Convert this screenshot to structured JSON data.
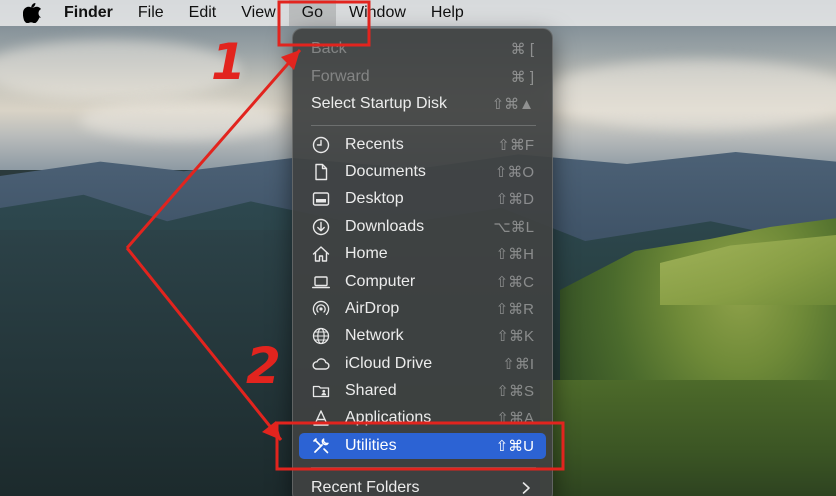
{
  "menubar": {
    "apple_icon": "apple-logo-icon",
    "app_name": "Finder",
    "items": [
      "File",
      "Edit",
      "View",
      "Go",
      "Window",
      "Help"
    ]
  },
  "go_menu": {
    "back": {
      "label": "Back",
      "shortcut": "⌘ ["
    },
    "forward": {
      "label": "Forward",
      "shortcut": "⌘ ]"
    },
    "startup": {
      "label": "Select Startup Disk",
      "shortcut": "⇧⌘▲"
    },
    "items": [
      {
        "label": "Recents",
        "shortcut": "⇧⌘F",
        "icon": "clock-icon"
      },
      {
        "label": "Documents",
        "shortcut": "⇧⌘O",
        "icon": "document-icon"
      },
      {
        "label": "Desktop",
        "shortcut": "⇧⌘D",
        "icon": "desktop-icon"
      },
      {
        "label": "Downloads",
        "shortcut": "⌥⌘L",
        "icon": "download-icon"
      },
      {
        "label": "Home",
        "shortcut": "⇧⌘H",
        "icon": "home-icon"
      },
      {
        "label": "Computer",
        "shortcut": "⇧⌘C",
        "icon": "laptop-icon"
      },
      {
        "label": "AirDrop",
        "shortcut": "⇧⌘R",
        "icon": "airdrop-icon"
      },
      {
        "label": "Network",
        "shortcut": "⇧⌘K",
        "icon": "globe-icon"
      },
      {
        "label": "iCloud Drive",
        "shortcut": "⇧⌘I",
        "icon": "cloud-icon"
      },
      {
        "label": "Shared",
        "shortcut": "⇧⌘S",
        "icon": "shared-folder-icon"
      },
      {
        "label": "Applications",
        "shortcut": "⇧⌘A",
        "icon": "applications-icon"
      },
      {
        "label": "Utilities",
        "shortcut": "⇧⌘U",
        "icon": "tools-icon"
      }
    ],
    "recent_folders": "Recent Folders"
  },
  "annotations": {
    "step1": "1",
    "step2": "2",
    "color": "#e2241e"
  },
  "colors": {
    "highlight": "#2c63d4",
    "menu_bg": "#404242"
  }
}
